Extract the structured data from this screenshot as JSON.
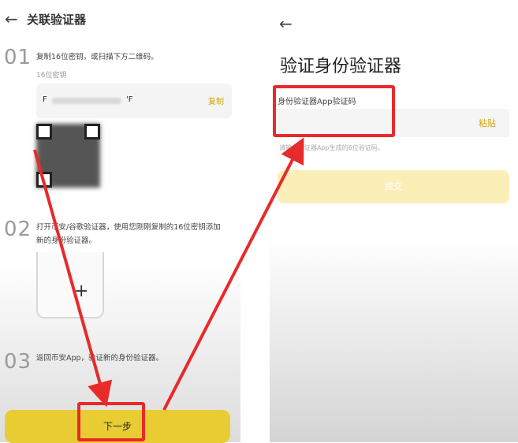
{
  "left_screen": {
    "back_glyph": "←",
    "title": "关联验证器",
    "step1": {
      "number": "01",
      "text": "复制16位密钥，或扫描下方二维码。",
      "key_label": "16位密钥",
      "key_start": "F",
      "key_end": "'F",
      "copy_label": "复制"
    },
    "step2": {
      "number": "02",
      "text_line1": "打开币安/谷歌验证器，使用您刚刚复制的16位密钥添加",
      "text_line2": "新的身份验证器。",
      "plus_glyph": "+"
    },
    "step3": {
      "number": "03",
      "text": "返回币安App，验证新的身份验证器。"
    },
    "next_label": "下一步"
  },
  "right_screen": {
    "back_glyph": "←",
    "title": "验证身份验证器",
    "field_label": "身份验证器App验证码",
    "paste_label": "粘贴",
    "hint": "请输入验证器App生成的6位验证码。",
    "submit_label": "提交"
  },
  "colors": {
    "accent": "#e9cc34",
    "highlight": "#e82a2a",
    "link": "#d4a600"
  }
}
